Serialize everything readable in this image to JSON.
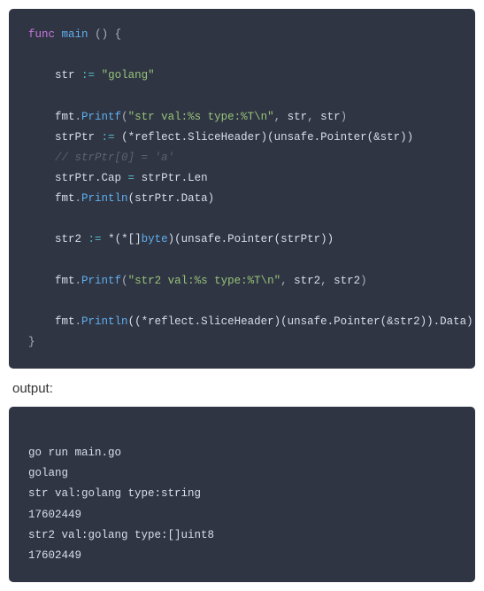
{
  "code": {
    "tokens": {
      "func": "func",
      "main": "main",
      "openParen1": "()",
      "openBrace": "{",
      "str": "str",
      "assign": ":=",
      "golang_lit": "\"golang\"",
      "fmt1": "fmt",
      "dot": ".",
      "printf": "Printf",
      "strvalFmt": "\"str val:%s type:%T\\n\"",
      "comma": ",",
      "strPtr": "strPtr",
      "starRef": "(*reflect.SliceHeader)",
      "unsafe": "(unsafe.Pointer(&str))",
      "comment": "// strPtr[0] = 'a'",
      "strPtrCap": "strPtr.Cap",
      "eq": "=",
      "strPtrLen": "strPtr.Len",
      "println": "Println",
      "strPtrData": "(strPtr.Data)",
      "str2": "str2",
      "castExpr": "*(*[]",
      "byte": "byte",
      "castRest": ")(unsafe.Pointer(strPtr))",
      "str2ValFmt": "\"str2 val:%s type:%T\\n\"",
      "printlnArg2": "((*reflect.SliceHeader)(unsafe.Pointer(&str2)).Data)",
      "closeBrace": "}",
      "openParen": "(",
      "closeParen": ")",
      "str_arg": " str",
      "str2_arg": " str2"
    }
  },
  "output_label": "output:",
  "output": {
    "line1": "go run main.go",
    "line2": "golang",
    "line3": "str val:golang type:string",
    "line4": "17602449",
    "line5": "str2 val:golang type:[]uint8",
    "line6": "17602449"
  }
}
